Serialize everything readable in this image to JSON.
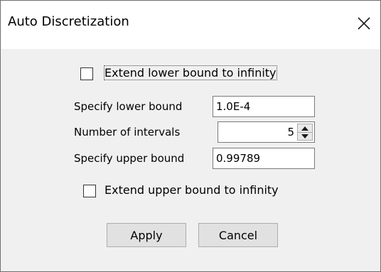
{
  "window": {
    "title": "Auto Discretization"
  },
  "form": {
    "extend_lower": {
      "label": "Extend lower bound to infinity",
      "checked": false
    },
    "lower_bound": {
      "label": "Specify lower bound",
      "value": "1.0E-4"
    },
    "intervals": {
      "label": "Number of intervals",
      "value": "5"
    },
    "upper_bound": {
      "label": "Specify upper bound",
      "value": "0.99789"
    },
    "extend_upper": {
      "label": "Extend upper bound to infinity",
      "checked": false
    }
  },
  "buttons": {
    "apply": "Apply",
    "cancel": "Cancel"
  },
  "icons": {
    "close": "close-icon",
    "spin_up": "triangle-up-icon",
    "spin_down": "triangle-down-icon"
  }
}
